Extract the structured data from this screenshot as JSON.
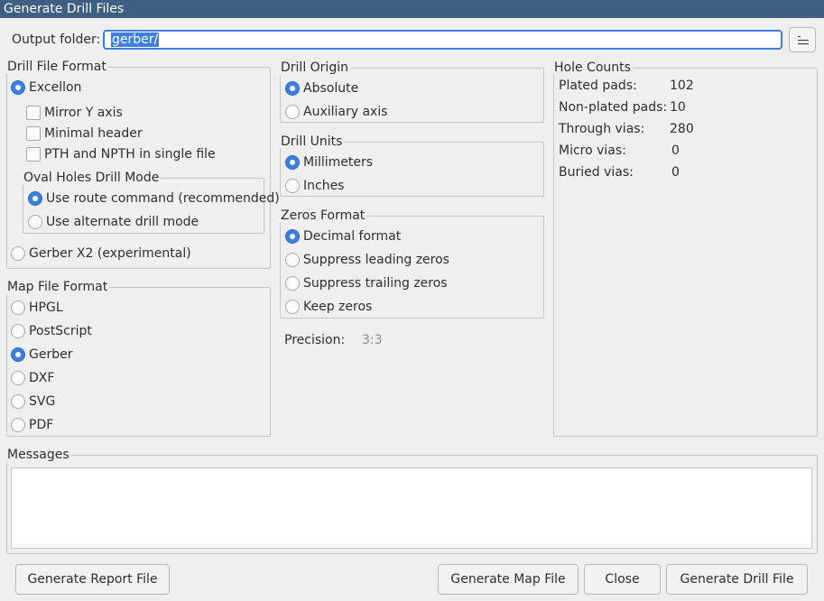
{
  "window": {
    "title": "Generate Drill Files"
  },
  "output": {
    "label": "Output folder:",
    "value": "gerber/"
  },
  "drill_file_format": {
    "title": "Drill File Format",
    "excellon": "Excellon",
    "options": [
      "Mirror Y axis",
      "Minimal header",
      "PTH and NPTH in single file"
    ],
    "oval": {
      "title": "Oval Holes Drill Mode",
      "route": "Use route command (recommended)",
      "alternate": "Use alternate drill mode"
    },
    "gerber_x2": "Gerber X2 (experimental)"
  },
  "map_file_format": {
    "title": "Map File Format",
    "options": [
      "HPGL",
      "PostScript",
      "Gerber",
      "DXF",
      "SVG",
      "PDF"
    ],
    "selected": "Gerber"
  },
  "drill_origin": {
    "title": "Drill Origin",
    "options": [
      "Absolute",
      "Auxiliary axis"
    ],
    "selected": "Absolute"
  },
  "drill_units": {
    "title": "Drill Units",
    "options": [
      "Millimeters",
      "Inches"
    ],
    "selected": "Millimeters"
  },
  "zeros_format": {
    "title": "Zeros Format",
    "options": [
      "Decimal format",
      "Suppress leading zeros",
      "Suppress trailing zeros",
      "Keep zeros"
    ],
    "selected": "Decimal format"
  },
  "precision": {
    "label": "Precision:",
    "value": "3:3"
  },
  "hole_counts": {
    "title": "Hole Counts",
    "rows": [
      {
        "label": "Plated pads:",
        "value": "102"
      },
      {
        "label": "Non-plated pads:",
        "value": "10"
      },
      {
        "label": "Through vias:",
        "value": "280"
      },
      {
        "label": "Micro vias:",
        "value": "0"
      },
      {
        "label": "Buried vias:",
        "value": "0"
      }
    ]
  },
  "messages": {
    "title": "Messages"
  },
  "buttons": {
    "report": "Generate Report File",
    "map": "Generate Map File",
    "close": "Close",
    "drill": "Generate Drill File"
  },
  "colors": {
    "accent": "#3d7fe0",
    "titlebar": "#3f5f82"
  },
  "icons": {
    "browse": "folder-browse-icon"
  }
}
